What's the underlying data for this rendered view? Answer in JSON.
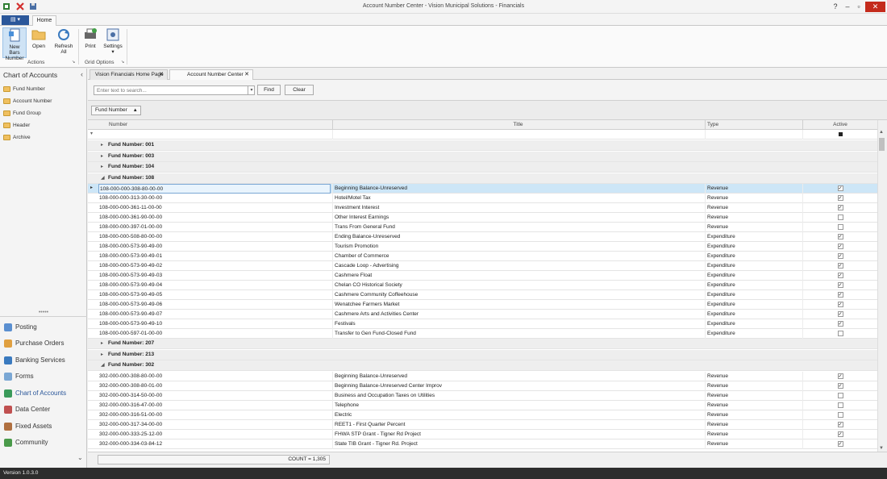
{
  "window": {
    "title": "Account Number Center - Vision Municipal Solutions - Financials",
    "controls": {
      "help": "?",
      "minimize": "–",
      "maximize": "▫",
      "close": "✕"
    }
  },
  "ribbon": {
    "home_tab": "Home",
    "actions_group": "Actions",
    "grid_options_group": "Grid Options",
    "new_line1": "New Bars",
    "new_line2": "Number",
    "open": "Open",
    "refresh_line1": "Refresh",
    "refresh_line2": "All",
    "print": "Print",
    "settings": "Settings",
    "settings_arrow": "▾"
  },
  "leftnav": {
    "title": "Chart of Accounts",
    "collapse_glyph": "‹",
    "splitter_glyph": "•••••",
    "tree": [
      "Fund Number",
      "Account Number",
      "Fund Group",
      "Header",
      "Archive"
    ],
    "modules": [
      {
        "label": "Posting",
        "color": "#5a8fd0"
      },
      {
        "label": "Purchase Orders",
        "color": "#e0a040"
      },
      {
        "label": "Banking Services",
        "color": "#3a7abf"
      },
      {
        "label": "Forms",
        "color": "#7aa7d4"
      },
      {
        "label": "Chart of Accounts",
        "color": "#3a9a5a"
      },
      {
        "label": "Data Center",
        "color": "#c05050"
      },
      {
        "label": "Fixed Assets",
        "color": "#b07040"
      },
      {
        "label": "Community",
        "color": "#4a9a4a"
      }
    ],
    "scroll_glyph": "⌄"
  },
  "doctabs": [
    {
      "label": "Vision Financials Home Page",
      "close": "✕"
    },
    {
      "label": "Account Number Center",
      "close": "✕"
    }
  ],
  "search": {
    "placeholder": "Enter text to search...",
    "dropdown_glyph": "▾",
    "find": "Find",
    "clear": "Clear"
  },
  "groupby": {
    "chip": "Fund Number",
    "arrow": "▲"
  },
  "grid": {
    "columns": [
      "Number",
      "Title",
      "Type",
      "Active"
    ],
    "filter_glyph": "▾",
    "groups": [
      {
        "label": "Fund Number: 001",
        "expanded": false,
        "rows": []
      },
      {
        "label": "Fund Number: 003",
        "expanded": false,
        "rows": []
      },
      {
        "label": "Fund Number: 104",
        "expanded": false,
        "rows": []
      },
      {
        "label": "Fund Number: 108",
        "expanded": true,
        "rows": [
          {
            "number": "108-000-000-308-80-00-00",
            "title": "Beginning Balance-Unreserved",
            "type": "Revenue",
            "active": true,
            "selected": true
          },
          {
            "number": "108-000-000-313-30-00-00",
            "title": "Hotel/Motel Tax",
            "type": "Revenue",
            "active": true
          },
          {
            "number": "108-000-000-361-11-00-00",
            "title": "Investment Interest",
            "type": "Revenue",
            "active": true
          },
          {
            "number": "108-000-000-361-90-00-00",
            "title": "Other Interest Earnings",
            "type": "Revenue",
            "active": false
          },
          {
            "number": "108-000-000-397-01-00-00",
            "title": "Trans From General Fund",
            "type": "Revenue",
            "active": false
          },
          {
            "number": "108-000-000-508-80-00-00",
            "title": "Ending Balance-Unreserved",
            "type": "Expenditure",
            "active": true
          },
          {
            "number": "108-000-000-573-90-49-00",
            "title": "Tourism Promotion",
            "type": "Expenditure",
            "active": true
          },
          {
            "number": "108-000-000-573-90-49-01",
            "title": "Chamber of Commerce",
            "type": "Expenditure",
            "active": true
          },
          {
            "number": "108-000-000-573-90-49-02",
            "title": "Cascade Loop - Advertising",
            "type": "Expenditure",
            "active": true
          },
          {
            "number": "108-000-000-573-90-49-03",
            "title": "Cashmere Float",
            "type": "Expenditure",
            "active": true
          },
          {
            "number": "108-000-000-573-90-49-04",
            "title": "Chelan CO Historical Society",
            "type": "Expenditure",
            "active": true
          },
          {
            "number": "108-000-000-573-90-49-05",
            "title": "Cashmere Community Coffeehouse",
            "type": "Expenditure",
            "active": true
          },
          {
            "number": "108-000-000-573-90-49-06",
            "title": "Wenatchee Farmers Market",
            "type": "Expenditure",
            "active": true
          },
          {
            "number": "108-000-000-573-90-49-07",
            "title": "Cashmere Arts and Activities Center",
            "type": "Expenditure",
            "active": true
          },
          {
            "number": "108-000-000-573-90-49-10",
            "title": "Festivals",
            "type": "Expenditure",
            "active": true
          },
          {
            "number": "108-000-000-597-01-00-00",
            "title": "Transfer to Gen Fund-Closed Fund",
            "type": "Expenditure",
            "active": false
          }
        ]
      },
      {
        "label": "Fund Number: 207",
        "expanded": false,
        "rows": []
      },
      {
        "label": "Fund Number: 213",
        "expanded": false,
        "rows": []
      },
      {
        "label": "Fund Number: 302",
        "expanded": true,
        "rows": [
          {
            "number": "302-000-000-308-80-00-00",
            "title": "Beginning Balance-Unreserved",
            "type": "Revenue",
            "active": true
          },
          {
            "number": "302-000-000-308-80-01-00",
            "title": "Beginning Balance-Unreserved Center Improv",
            "type": "Revenue",
            "active": true
          },
          {
            "number": "302-000-000-314-50-00-00",
            "title": "Business and Occupation Taxes on Utilities",
            "type": "Revenue",
            "active": false
          },
          {
            "number": "302-000-000-316-47-00-00",
            "title": "Telephone",
            "type": "Revenue",
            "active": false
          },
          {
            "number": "302-000-000-316-51-00-00",
            "title": "Electric",
            "type": "Revenue",
            "active": false
          },
          {
            "number": "302-000-000-317-34-00-00",
            "title": "REET1 - First Quarter Percent",
            "type": "Revenue",
            "active": true
          },
          {
            "number": "302-000-000-333-25-12-00",
            "title": "FHWA STP Grant - Tigner Rd Project",
            "type": "Revenue",
            "active": true
          },
          {
            "number": "302-000-000-334-03-84-12",
            "title": "State TIB Grant - Tigner Rd. Project",
            "type": "Revenue",
            "active": true
          }
        ]
      }
    ]
  },
  "footer": {
    "count": "COUNT = 1,305"
  },
  "status": {
    "version": "Version 1.0.3.0"
  }
}
